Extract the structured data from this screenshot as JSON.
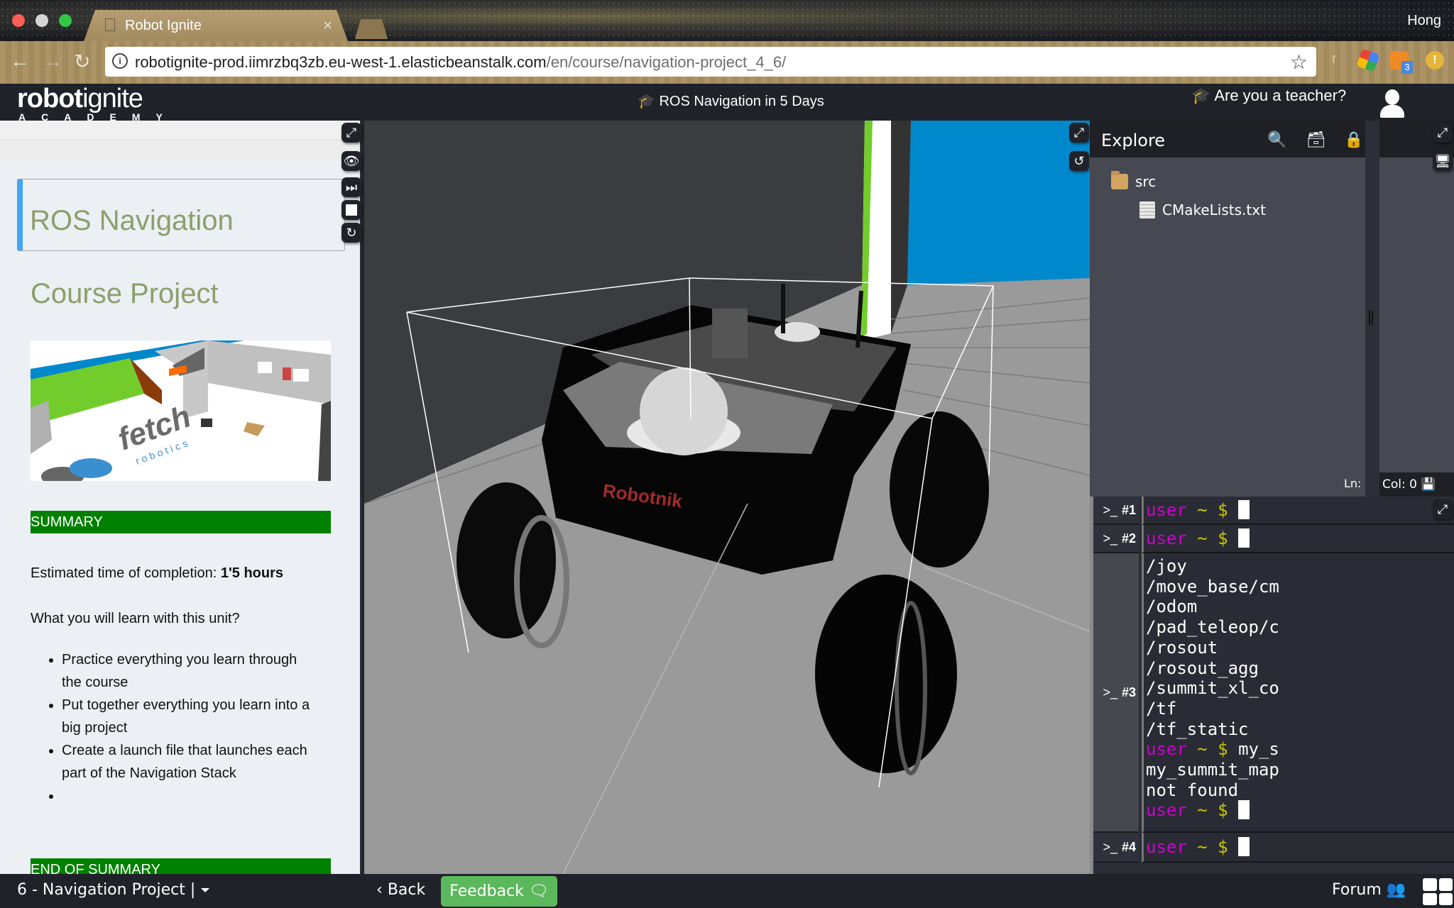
{
  "browser": {
    "tab_title": "Robot Ignite",
    "tab_close": "×",
    "profile_name": "Hong",
    "url_host": "robotignite-prod.iimrzbq3zb.eu-west-1.elasticbeanstalk.com",
    "url_path": "/en/course/navigation-project_4_6/",
    "extensions": [
      {
        "name": "r-extension",
        "glyph": "r"
      },
      {
        "name": "maps-extension"
      },
      {
        "name": "hubspot-extension",
        "badge": "3"
      },
      {
        "name": "alert-extension",
        "glyph": "!"
      }
    ]
  },
  "header": {
    "logo_bold": "robot",
    "logo_light": "ignite",
    "logo_sub": "ACADEMY",
    "course_title": "ROS Navigation in 5 Days",
    "teacher_link": "Are you a teacher?"
  },
  "notebook": {
    "title": "ROS Navigation",
    "subtitle": "Course Project",
    "image_caption_brand": "fetch",
    "image_caption_sub": "robotics",
    "summary_label": "SUMMARY",
    "estimated_label": "Estimated time of completion:",
    "estimated_value": "1'5 hours",
    "learn_question": "What you will learn with this unit?",
    "learn_items": [
      "Practice everything you learn through the course",
      "Put together everything you learn into a big project",
      "Create a launch file that launches each part of the Navigation Stack",
      ""
    ],
    "end_summary_label": "END OF SUMMARY"
  },
  "viewport": {
    "robot_brand": "Robotnik"
  },
  "ide": {
    "explore_title": "Explore",
    "tree": [
      {
        "type": "folder",
        "name": "src"
      },
      {
        "type": "file",
        "name": "CMakeLists.txt"
      }
    ],
    "status_ln": "Ln:",
    "status_col": "Col: 0",
    "save_label": "Save"
  },
  "shells": [
    {
      "id": "#1",
      "lines": [
        {
          "prompt": true,
          "cmd": ""
        }
      ]
    },
    {
      "id": "#2",
      "lines": [
        {
          "prompt": true,
          "cmd": ""
        }
      ]
    },
    {
      "id": "#3",
      "lines": [
        {
          "text": "/joy"
        },
        {
          "text": "/move_base/cm"
        },
        {
          "text": "/odom"
        },
        {
          "text": "/pad_teleop/c"
        },
        {
          "text": "/rosout"
        },
        {
          "text": "/rosout_agg"
        },
        {
          "text": "/summit_xl_co"
        },
        {
          "text": "/tf"
        },
        {
          "text": "/tf_static"
        },
        {
          "prompt": true,
          "cmd": "my_s"
        },
        {
          "text": "my_summit_map"
        },
        {
          "text": "not found"
        },
        {
          "prompt": true,
          "cmd": "",
          "cursor": true
        }
      ]
    },
    {
      "id": "#4",
      "lines": [
        {
          "prompt": true,
          "cmd": ""
        }
      ]
    }
  ],
  "prompt": {
    "user": "user",
    "tilde": "~",
    "dollar": "$"
  },
  "footer": {
    "unit_label": "6 - Navigation Project |",
    "back_label": "Back",
    "feedback_label": "Feedback",
    "forum_label": "Forum"
  },
  "colors": {
    "accent_green": "#5cb85c",
    "summary_green": "#008000",
    "title_olive": "#8d9f6a",
    "title_border_blue": "#42a5f5",
    "prompt_user": "#d000d0",
    "prompt_symbol": "#c8c800"
  }
}
